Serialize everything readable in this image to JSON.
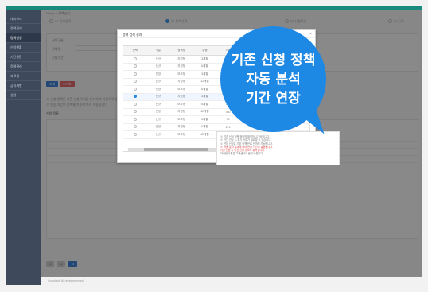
{
  "topbar": {
    "accent": "#1a8a7c"
  },
  "sidebar": {
    "items": [
      {
        "label": "대시보드",
        "active": false
      },
      {
        "label": "정책검색",
        "active": false
      },
      {
        "label": "정책신청",
        "active": true
      },
      {
        "label": "신청현황",
        "active": false
      },
      {
        "label": "기간연장",
        "active": false
      },
      {
        "label": "정책관리",
        "active": false
      },
      {
        "label": "자료실",
        "active": false
      },
      {
        "label": "공지사항",
        "active": false
      },
      {
        "label": "설정",
        "active": false
      }
    ]
  },
  "main": {
    "breadcrumb": "Home > 정책신청",
    "steps": [
      "01 정보입력",
      "02 정책선택",
      "03 신청확인",
      "04 완료"
    ],
    "labels": [
      "신청구분",
      "정책명",
      "신청기간",
      "신청금액",
      "비고"
    ],
    "buttons": {
      "search": "조회",
      "reset": "초기화"
    },
    "notes": [
      "※ 신청 정책은 기존 신청 이력을 분석하여 자동으로 연장됩니다.",
      "※ 연장 기간은 정책별 기준에 따라 적용됩니다."
    ],
    "section_title": "신청 목록",
    "pagination": [
      "1",
      "2",
      "3"
    ]
  },
  "modal": {
    "title": "정책 검색 결과",
    "close": "×",
    "columns": [
      "선택",
      "구분",
      "정책명",
      "유형",
      "기간",
      "금액",
      "상태",
      "비고"
    ],
    "rows": [
      [
        "신규",
        "지원형",
        "3개월",
        "100",
        "가능"
      ],
      [
        "신규",
        "지원형",
        "6개월",
        "200",
        "가능"
      ],
      [
        "연장",
        "보조형",
        "3개월",
        "150",
        "가능"
      ],
      [
        "신규",
        "지원형",
        "12개월",
        "300",
        "가능"
      ],
      [
        "연장",
        "보조형",
        "6개월",
        "250",
        "가능"
      ],
      [
        "신규",
        "지원형",
        "3개월",
        "120",
        "가능"
      ],
      [
        "신규",
        "보조형",
        "6개월",
        "180",
        "가능"
      ],
      [
        "연장",
        "지원형",
        "12개월",
        "360",
        "가능"
      ],
      [
        "신규",
        "보조형",
        "3개월",
        "90",
        "가능"
      ],
      [
        "연장",
        "지원형",
        "6개월",
        "210",
        "가능"
      ],
      [
        "신규",
        "보조형",
        "12개월",
        "400",
        "가능"
      ]
    ],
    "selected_row": 5,
    "info_lines": [
      "※ 기존 신청 정책 정보를 확인하시기 바랍니다.",
      "※ 기간 연장 시 추가 서류가 필요할 수 있습니다.",
      "※ 연장 신청은 기존 정책 만료 전까지 가능합니다.",
      "※ 자동 분석 결과에 따라 연장 기간이 결정됩니다.",
      "기간 연장 시 이전 신청 정보가 유지됩니다.",
      "자세한 사항은 고객센터로 문의 바랍니다."
    ],
    "info_red_index": [
      3,
      4
    ],
    "buttons": {
      "cancel": "취소",
      "confirm": "확인"
    }
  },
  "bubble": {
    "lines": [
      "기존 신청 정책",
      "자동 분석",
      "기간 연장"
    ],
    "color": "#1e88e5"
  },
  "footer": {
    "text": "Copyright. All rights reserved."
  }
}
